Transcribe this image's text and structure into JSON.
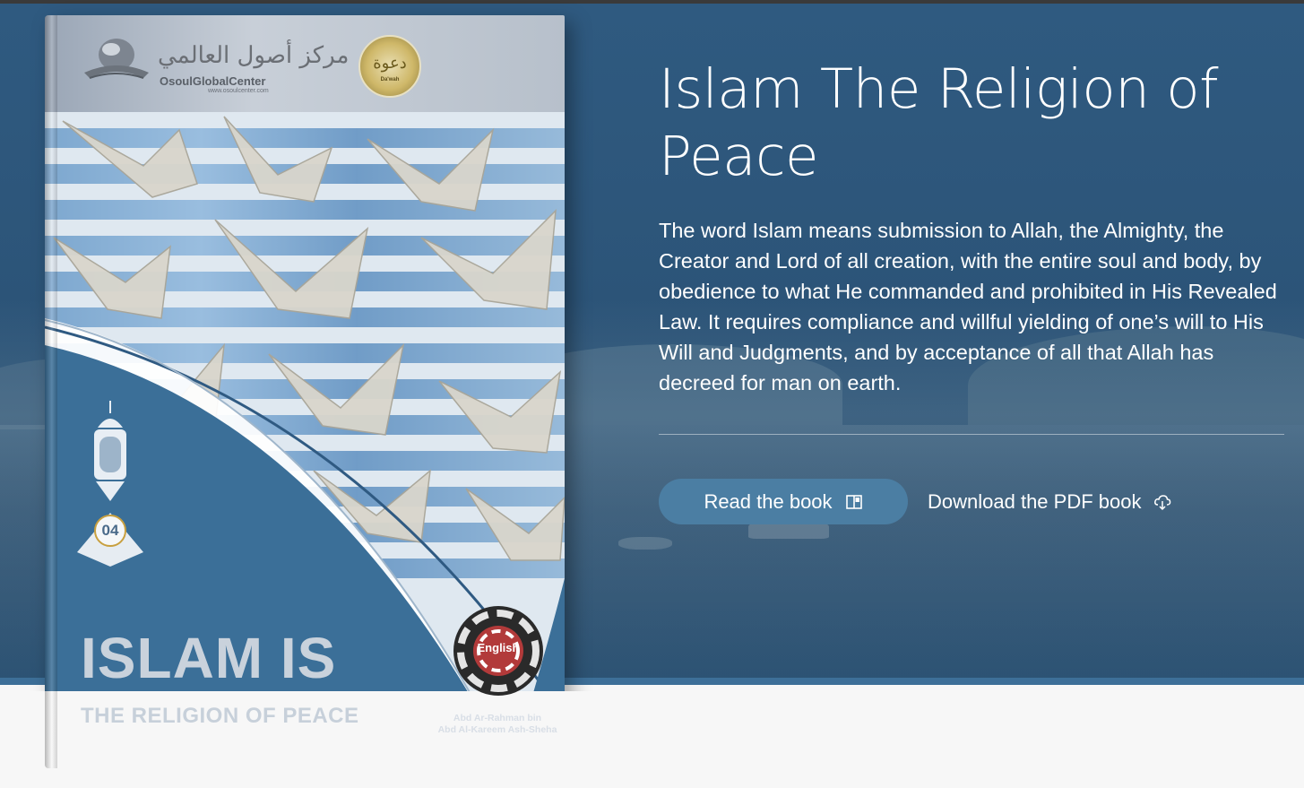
{
  "hero": {
    "title": "Islam The Religion of Peace",
    "description": "The word Islam means submission to Allah, the Almighty, the Creator and Lord of all creation, with the entire soul and body, by obedience to what He commanded and prohibited in His Revealed Law. It requires compliance and willful yielding of one’s will to His Will and Judgments, and by acceptance of all that Allah has decreed for man on earth.",
    "read_label": "Read the book",
    "read_icon": "open-book-icon",
    "download_label": "Download the PDF book",
    "download_icon": "cloud-download-icon"
  },
  "book_cover": {
    "publisher_arabic": "مركز أصول العالمي",
    "publisher_latin": "OsoulGlobalCenter",
    "publisher_url": "www.osoulcenter.com",
    "seal_text": "دعوة",
    "seal_sub": "Da'wah",
    "volume_number": "04",
    "cover_title": "ISLAM IS",
    "cover_subtitle": "THE RELIGION OF PEACE",
    "language_badge": "English",
    "author_line1": "Abd Ar-Rahman bin",
    "author_line2": "Abd Al-Kareem Ash-Sheha"
  },
  "colors": {
    "hero_bg": "#2d5678",
    "button_bg": "#4b7ea3",
    "page_bg": "#f7f7f7"
  }
}
